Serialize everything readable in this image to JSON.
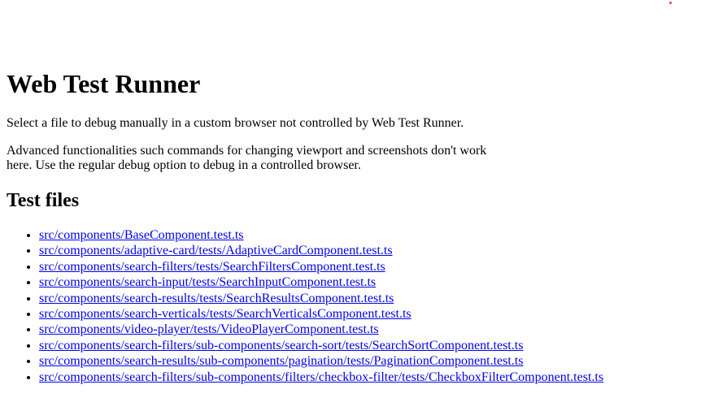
{
  "colors": {
    "link": "#0000ee",
    "indicator_dot": "#e53935"
  },
  "title": "Web Test Runner",
  "intro": "Select a file to debug manually in a custom browser not controlled by Web Test Runner.",
  "note": "Advanced functionalities such commands for changing viewport and screenshots don't work here. Use the regular debug option to debug in a controlled browser.",
  "files_heading": "Test files",
  "files": [
    "src/components/BaseComponent.test.ts",
    "src/components/adaptive-card/tests/AdaptiveCardComponent.test.ts",
    "src/components/search-filters/tests/SearchFiltersComponent.test.ts",
    "src/components/search-input/tests/SearchInputComponent.test.ts",
    "src/components/search-results/tests/SearchResultsComponent.test.ts",
    "src/components/search-verticals/tests/SearchVerticalsComponent.test.ts",
    "src/components/video-player/tests/VideoPlayerComponent.test.ts",
    "src/components/search-filters/sub-components/search-sort/tests/SearchSortComponent.test.ts",
    "src/components/search-results/sub-components/pagination/tests/PaginationComponent.test.ts",
    "src/components/search-filters/sub-components/filters/checkbox-filter/tests/CheckboxFilterComponent.test.ts"
  ]
}
